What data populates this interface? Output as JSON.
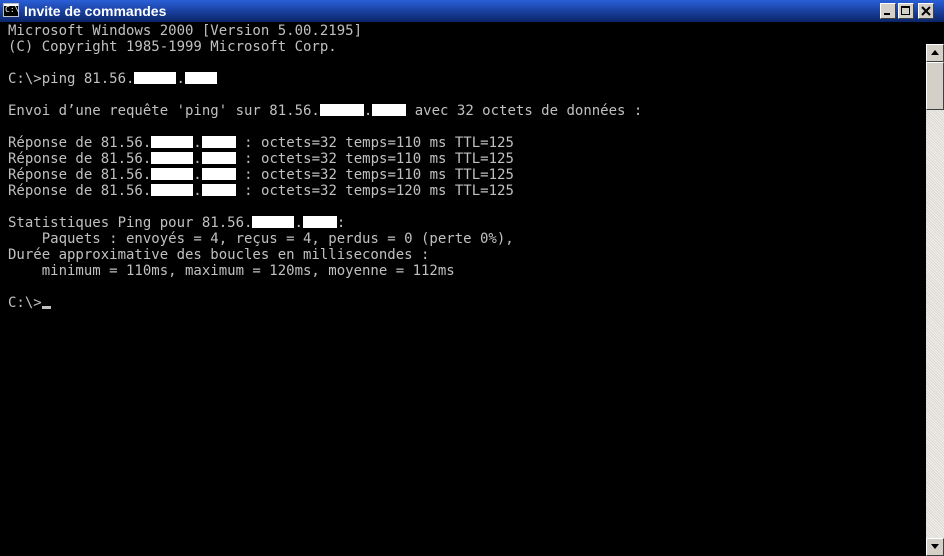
{
  "window": {
    "title": "Invite de commandes",
    "icon": "cmd-icon",
    "controls": [
      "minimize-icon",
      "maximize-icon",
      "close-icon"
    ]
  },
  "console": {
    "lines": [
      "Microsoft Windows 2000 [Version 5.00.2195]",
      "(C) Copyright 1985-1999 Microsoft Corp.",
      "",
      "C:\\>ping 81.56.",
      "",
      "Envoi d’une requête 'ping' sur 81.56.",
      "",
      "Réponse de 81.56.",
      "Réponse de 81.56.",
      "Réponse de 81.56.",
      "Réponse de 81.56.",
      "",
      "Statistiques Ping pour 81.56.",
      "    Paquets : envoyés = 4, reçus = 4, perdus = 0 (perte 0%),",
      "Durée approximative des boucles en millisecondes :",
      "    minimum = 110ms, maximum = 120ms, moyenne = 112ms",
      "",
      "C:\\>"
    ],
    "ping_suffix": " avec 32 octets de données :",
    "replies": [
      " : octets=32 temps=110 ms TTL=125",
      " : octets=32 temps=110 ms TTL=125",
      " : octets=32 temps=110 ms TTL=125",
      " : octets=32 temps=120 ms TTL=125"
    ],
    "stats_suffix": ":",
    "dot": "."
  },
  "colors": {
    "background": "#000000",
    "text": "#c0c0c0",
    "titlebar": "#0a246a"
  }
}
